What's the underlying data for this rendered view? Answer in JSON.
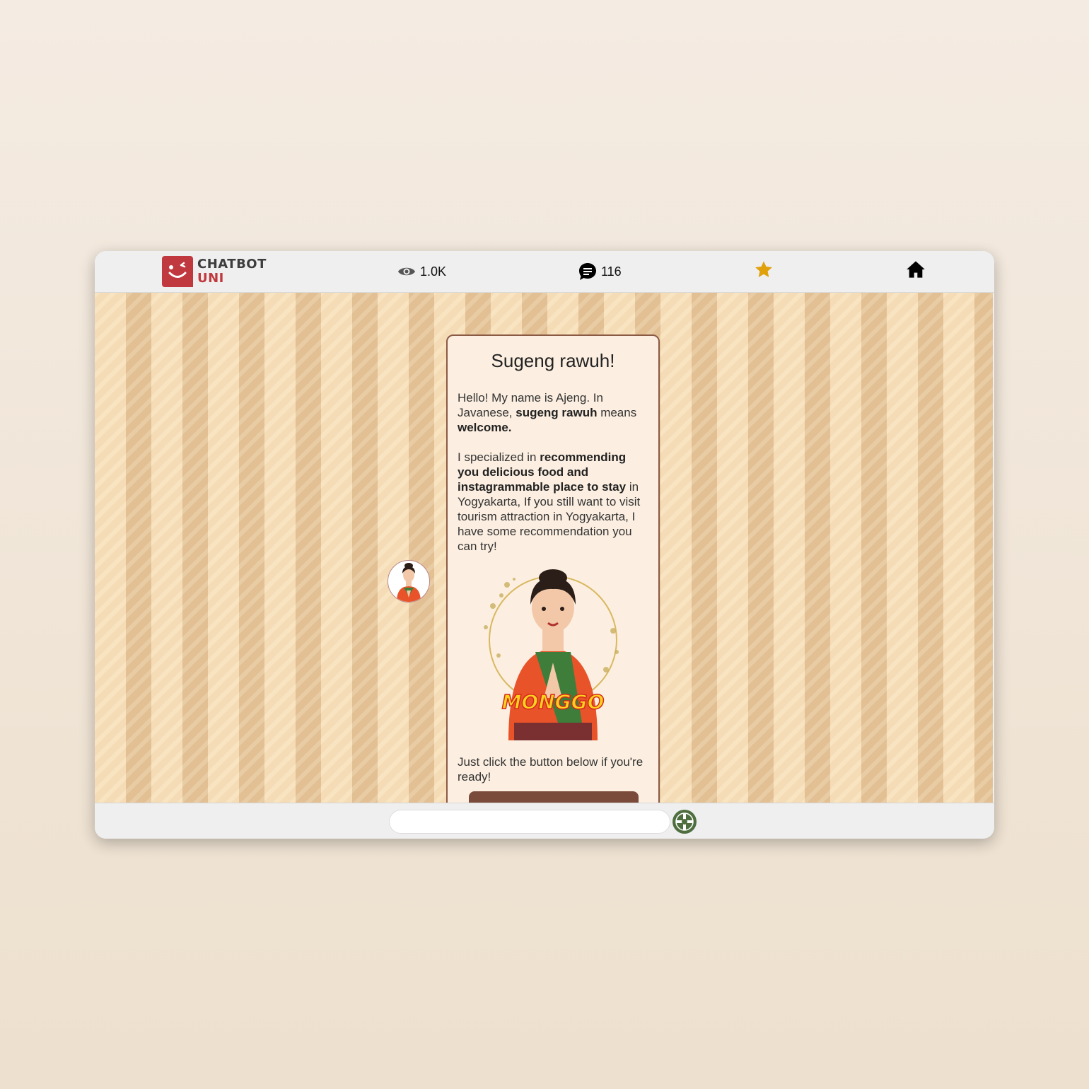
{
  "header": {
    "logo_line1": "CHATBOT",
    "logo_line2": "UNI",
    "views": "1.0K",
    "messages": "116"
  },
  "card": {
    "title": "Sugeng rawuh!",
    "intro_a": "Hello! My name is Ajeng. In Javanese, ",
    "intro_bold1": "sugeng rawuh",
    "intro_b": "  means  ",
    "intro_bold2": "welcome.",
    "spec_a": "I specialized in  ",
    "spec_bold": "recommending you delicious food and instagrammable place to stay",
    "spec_b": "  in Yogyakarta, If you still want to visit tourism attraction in Yogyakarta, I have some recommendation you can try!",
    "illustration_label": "MONGGO",
    "outro": "Just click the button below if you're ready!"
  },
  "composer": {
    "placeholder": ""
  },
  "colors": {
    "brand": "#c0393f",
    "card_border": "#8a5a45",
    "star": "#e0a10a",
    "button": "#7a4a3a"
  },
  "icons": [
    "logo-icon",
    "eye-icon",
    "chat-icon",
    "star-icon",
    "home-icon",
    "send-icon"
  ]
}
